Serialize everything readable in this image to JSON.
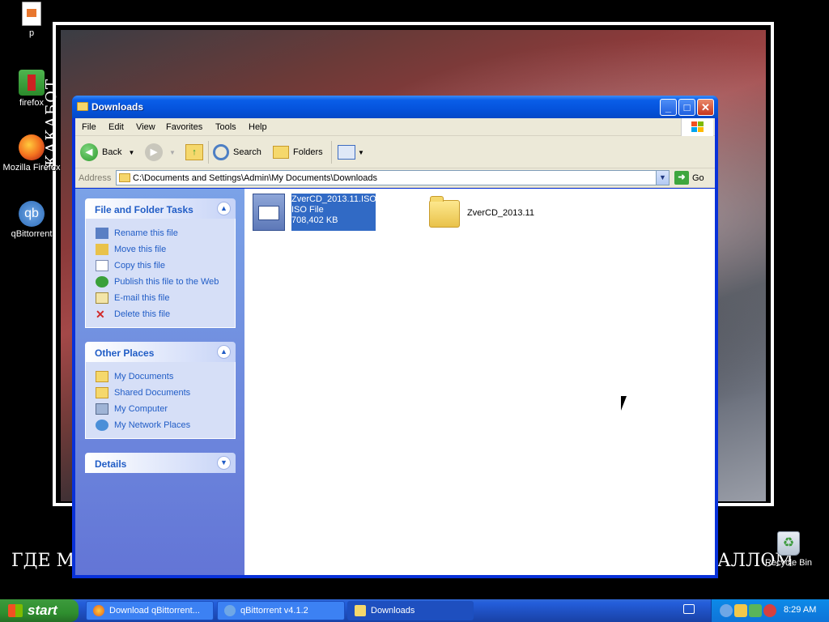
{
  "desktop": {
    "icons": [
      {
        "label": "p"
      },
      {
        "label": "firefox"
      },
      {
        "label": "Mozilla Firefox"
      },
      {
        "label": "qBittorrent"
      },
      {
        "label": "Recycle Bin"
      }
    ],
    "wallpaper_vertical_text": "ЖАКАБОТ",
    "wallpaper_bottom_left": "ГДЕ М",
    "wallpaper_bottom_right": "АЛЛОМ"
  },
  "window": {
    "title": "Downloads",
    "buttons": {
      "minimize": "_",
      "maximize": "□",
      "close": "✕"
    },
    "menu": [
      "File",
      "Edit",
      "View",
      "Favorites",
      "Tools",
      "Help"
    ],
    "toolbar": {
      "back": "Back",
      "search": "Search",
      "folders": "Folders"
    },
    "address": {
      "label": "Address",
      "value": "C:\\Documents and Settings\\Admin\\My Documents\\Downloads",
      "go": "Go"
    },
    "sidebar": {
      "file_tasks": {
        "title": "File and Folder Tasks",
        "items": [
          "Rename this file",
          "Move this file",
          "Copy this file",
          "Publish this file to the Web",
          "E-mail this file",
          "Delete this file"
        ]
      },
      "other_places": {
        "title": "Other Places",
        "items": [
          "My Documents",
          "Shared Documents",
          "My Computer",
          "My Network Places"
        ]
      },
      "details": {
        "title": "Details"
      }
    },
    "files": [
      {
        "name": "ZverCD_2013.11.ISO",
        "type": "ISO File",
        "size": "708,402 KB",
        "selected": true
      },
      {
        "name": "ZverCD_2013.11",
        "type": "folder"
      }
    ]
  },
  "taskbar": {
    "start": "start",
    "buttons": [
      "Download qBittorrent...",
      "qBittorrent v4.1.2",
      "Downloads"
    ],
    "clock": "8:29 AM"
  }
}
